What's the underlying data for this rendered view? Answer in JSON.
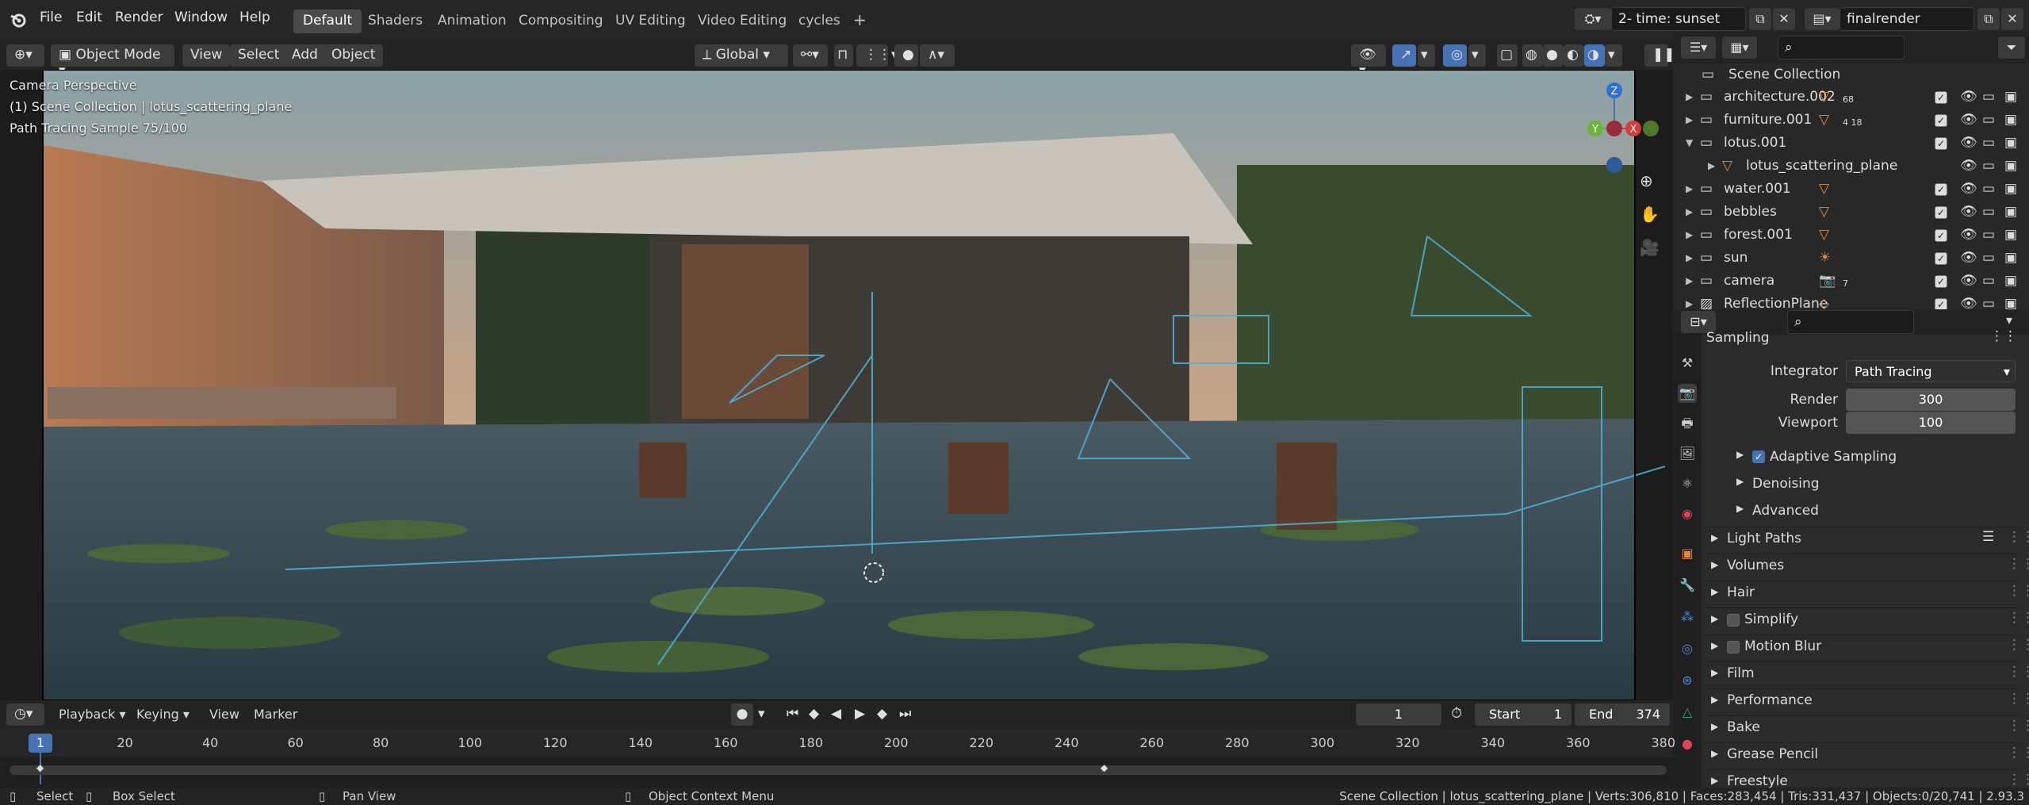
{
  "menubar": {
    "items": [
      "File",
      "Edit",
      "Render",
      "Window",
      "Help"
    ]
  },
  "workspaces": [
    "Default",
    "Shaders",
    "Animation",
    "Compositing",
    "UV Editing",
    "Video Editing",
    "cycles"
  ],
  "scene": {
    "name": "2- time: sunset",
    "view_layer": "finalrender"
  },
  "viewport_header": {
    "mode": "Object Mode",
    "menus": [
      "View",
      "Select",
      "Add",
      "Object"
    ],
    "orientation": "Global"
  },
  "viewport": {
    "info": [
      "Camera Perspective",
      "(1) Scene Collection | lotus_scattering_plane",
      "Path Tracing Sample 75/100"
    ],
    "axes": [
      "X",
      "Y",
      "Z"
    ]
  },
  "outliner": {
    "root": "Scene Collection",
    "rows": [
      {
        "name": "architecture.002",
        "badge": "68"
      },
      {
        "name": "furniture.001",
        "badge": "4  18"
      },
      {
        "name": "lotus.001",
        "badge": ""
      },
      {
        "name": "lotus_scattering_plane",
        "badge": ""
      },
      {
        "name": "water.001",
        "badge": ""
      },
      {
        "name": "bebbles",
        "badge": ""
      },
      {
        "name": "forest.001",
        "badge": ""
      },
      {
        "name": "sun",
        "badge": ""
      },
      {
        "name": "camera",
        "badge": "7"
      },
      {
        "name": "ReflectionPlane",
        "badge": ""
      }
    ]
  },
  "properties": {
    "section": "Sampling",
    "integrator_label": "Integrator",
    "integrator": "Path Tracing",
    "render_label": "Render",
    "render": "300",
    "viewport_label": "Viewport",
    "viewport": "100",
    "adaptive": "Adaptive Sampling",
    "subpanels": [
      "Denoising",
      "Advanced"
    ],
    "panels": [
      "Light Paths",
      "Volumes",
      "Hair",
      "Simplify",
      "Motion Blur",
      "Film",
      "Performance",
      "Bake",
      "Grease Pencil",
      "Freestyle"
    ]
  },
  "timeline": {
    "menus": [
      "Playback",
      "Keying",
      "View",
      "Marker"
    ],
    "current_frame": "1",
    "start_label": "Start",
    "start": "1",
    "end_label": "End",
    "end": "374",
    "ticks": [
      "20",
      "40",
      "60",
      "80",
      "100",
      "120",
      "140",
      "160",
      "180",
      "200",
      "220",
      "240",
      "260",
      "280",
      "300",
      "320",
      "340",
      "360",
      "380"
    ],
    "frame_badge": "1"
  },
  "statusbar": {
    "select": "Select",
    "box_select": "Box Select",
    "pan_view": "Pan View",
    "context_menu": "Object Context Menu",
    "stats": "Scene Collection | lotus_scattering_plane | Verts:306,810 | Faces:283,454 | Tris:331,437 | Objects:0/20,741 | 2.93.3"
  },
  "colors": {
    "accent": "#4772b3",
    "selected_row": "#334d80",
    "orange": "#e8883a"
  }
}
